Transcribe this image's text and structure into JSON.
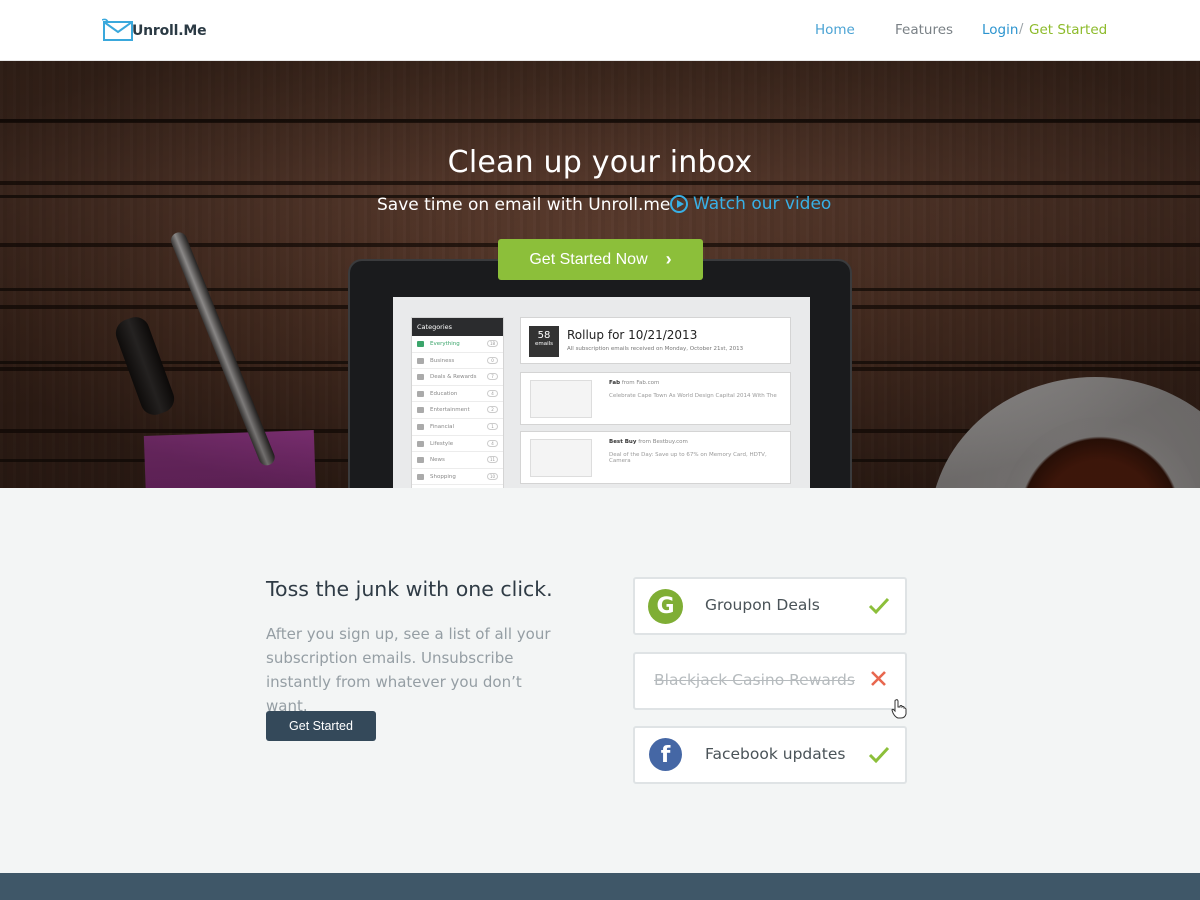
{
  "nav": {
    "logo_text": "Unroll.Me",
    "home": "Home",
    "features": "Features",
    "login": "Login",
    "separator": "/",
    "get_started": "Get Started"
  },
  "hero": {
    "title": "Clean up your inbox",
    "subtitle": "Save time on email with Unroll.me",
    "video_link": "Watch our video",
    "cta": "Get Started Now"
  },
  "screen": {
    "categories_header": "Categories",
    "categories": [
      {
        "label": "Everything",
        "count": "18"
      },
      {
        "label": "Business",
        "count": "0"
      },
      {
        "label": "Deals & Rewards",
        "count": "7"
      },
      {
        "label": "Education",
        "count": "4"
      },
      {
        "label": "Entertainment",
        "count": "2"
      },
      {
        "label": "Financial",
        "count": "1"
      },
      {
        "label": "Lifestyle",
        "count": "4"
      },
      {
        "label": "News",
        "count": "11"
      },
      {
        "label": "Shopping",
        "count": "10"
      }
    ],
    "rollup_count": "58",
    "rollup_unit": "emails",
    "rollup_title": "Rollup for 10/21/2013",
    "rollup_sub": "All subscription emails received on Monday, October 21st, 2013",
    "mails": [
      {
        "sender": "Fab",
        "from": "from Fab.com",
        "subject": "Celebrate Cape Town As World Design Capital 2014 With The"
      },
      {
        "sender": "Best Buy",
        "from": "from Bestbuy.com",
        "subject": "Deal of the Day: Save up to 67% on Memory Card, HDTV, Camera"
      }
    ]
  },
  "feature": {
    "title": "Toss the junk with one click.",
    "description": "After you sign up, see a list of all your subscription emails. Unsubscribe instantly from whatever you don’t want.",
    "button": "Get Started"
  },
  "subscriptions": [
    {
      "label": "Groupon Deals",
      "icon": "groupon-icon",
      "status": "kept"
    },
    {
      "label": "Blackjack Casino Rewards",
      "icon": "",
      "status": "removed"
    },
    {
      "label": "Facebook updates",
      "icon": "facebook-icon",
      "status": "kept"
    }
  ],
  "colors": {
    "accent_green": "#8cbf3a",
    "link_blue": "#38b0e6",
    "dark_button": "#34495a",
    "remove_red": "#e8674f",
    "footer": "#3f5768"
  }
}
